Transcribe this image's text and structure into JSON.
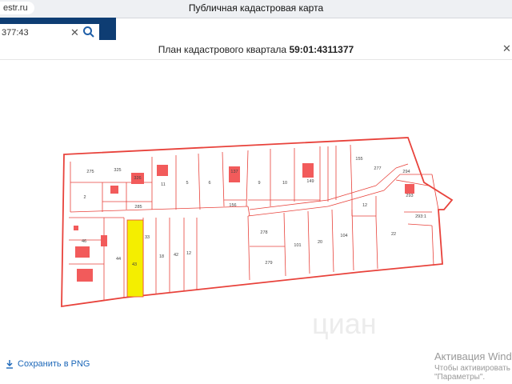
{
  "browser": {
    "url_fragment": "estr.ru",
    "window_title": "Публичная кадастровая карта"
  },
  "background_search": {
    "value": "377:43",
    "clear_glyph": "✕"
  },
  "modal": {
    "title_prefix": "План кадастрового квартала",
    "quarter_number": "59:01:4311377",
    "close_glyph": "✕"
  },
  "plan": {
    "parcel_labels": [
      "275",
      "325",
      "326",
      "2",
      "285",
      "11",
      "5",
      "6",
      "137",
      "9",
      "10",
      "149",
      "155",
      "277",
      "294",
      "293",
      "12",
      "156",
      "46",
      "44",
      "43",
      "33",
      "18",
      "42",
      "12",
      "278",
      "279",
      "101",
      "20",
      "104",
      "22",
      "293:1"
    ],
    "colors": {
      "boundary": "#e8423b",
      "building": "#f25b5b",
      "highlight": "#f4ee00"
    }
  },
  "save_link": {
    "label": "Сохранить в PNG",
    "icon": "download-icon"
  },
  "activation": {
    "line1": "Активация Windo",
    "line2": "Чтобы активировать W",
    "line3": "\"Параметры\"."
  },
  "watermark": {
    "text": "циан"
  }
}
